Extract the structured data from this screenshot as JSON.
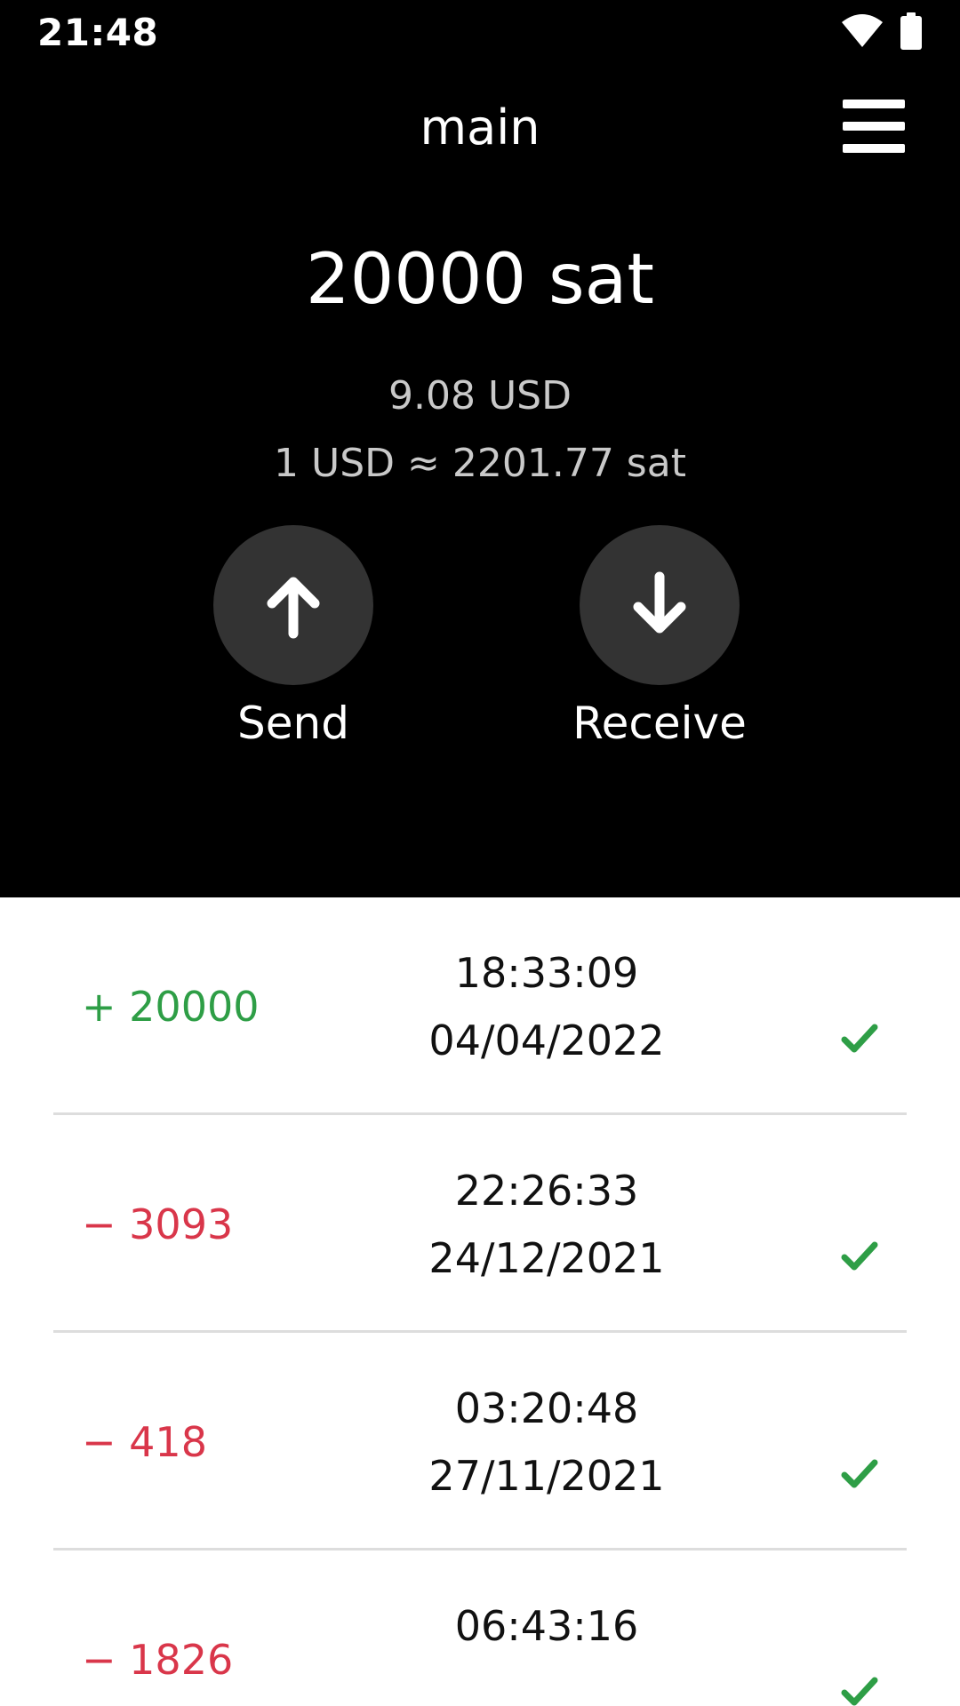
{
  "status_bar": {
    "time": "21:48",
    "icons": [
      "wifi-icon",
      "battery-icon"
    ]
  },
  "header": {
    "title": "main",
    "menu_icon": "hamburger-menu-icon"
  },
  "balance": {
    "amount": "20000 sat",
    "fiat": "9.08 USD",
    "rate": "1 USD ≈ 2201.77 sat"
  },
  "actions": {
    "send_label": "Send",
    "send_icon": "arrow-up-icon",
    "receive_label": "Receive",
    "receive_icon": "arrow-down-icon"
  },
  "transactions": [
    {
      "amount": "+ 20000",
      "direction": "in",
      "time": "18:33:09",
      "date": "04/04/2022",
      "status_icon": "check-icon"
    },
    {
      "amount": "− 3093",
      "direction": "out",
      "time": "22:26:33",
      "date": "24/12/2021",
      "status_icon": "check-icon"
    },
    {
      "amount": "− 418",
      "direction": "out",
      "time": "03:20:48",
      "date": "27/11/2021",
      "status_icon": "check-icon"
    },
    {
      "amount": "− 1826",
      "direction": "out",
      "time": "06:43:16",
      "date": "",
      "status_icon": "check-icon"
    }
  ],
  "colors": {
    "header_background": "#000000",
    "action_button": "#333333",
    "incoming": "#2e9e46",
    "outgoing": "#d9364a",
    "confirmed": "#2e9e46",
    "divider": "#dddddd"
  }
}
